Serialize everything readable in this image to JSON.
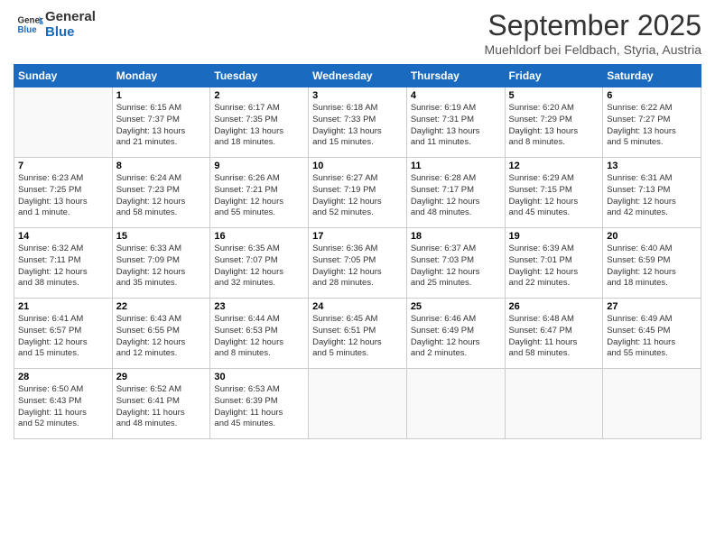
{
  "logo": {
    "line1": "General",
    "line2": "Blue"
  },
  "title": "September 2025",
  "subtitle": "Muehldorf bei Feldbach, Styria, Austria",
  "days_of_week": [
    "Sunday",
    "Monday",
    "Tuesday",
    "Wednesday",
    "Thursday",
    "Friday",
    "Saturday"
  ],
  "weeks": [
    [
      {
        "day": "",
        "info": ""
      },
      {
        "day": "1",
        "info": "Sunrise: 6:15 AM\nSunset: 7:37 PM\nDaylight: 13 hours\nand 21 minutes."
      },
      {
        "day": "2",
        "info": "Sunrise: 6:17 AM\nSunset: 7:35 PM\nDaylight: 13 hours\nand 18 minutes."
      },
      {
        "day": "3",
        "info": "Sunrise: 6:18 AM\nSunset: 7:33 PM\nDaylight: 13 hours\nand 15 minutes."
      },
      {
        "day": "4",
        "info": "Sunrise: 6:19 AM\nSunset: 7:31 PM\nDaylight: 13 hours\nand 11 minutes."
      },
      {
        "day": "5",
        "info": "Sunrise: 6:20 AM\nSunset: 7:29 PM\nDaylight: 13 hours\nand 8 minutes."
      },
      {
        "day": "6",
        "info": "Sunrise: 6:22 AM\nSunset: 7:27 PM\nDaylight: 13 hours\nand 5 minutes."
      }
    ],
    [
      {
        "day": "7",
        "info": "Sunrise: 6:23 AM\nSunset: 7:25 PM\nDaylight: 13 hours\nand 1 minute."
      },
      {
        "day": "8",
        "info": "Sunrise: 6:24 AM\nSunset: 7:23 PM\nDaylight: 12 hours\nand 58 minutes."
      },
      {
        "day": "9",
        "info": "Sunrise: 6:26 AM\nSunset: 7:21 PM\nDaylight: 12 hours\nand 55 minutes."
      },
      {
        "day": "10",
        "info": "Sunrise: 6:27 AM\nSunset: 7:19 PM\nDaylight: 12 hours\nand 52 minutes."
      },
      {
        "day": "11",
        "info": "Sunrise: 6:28 AM\nSunset: 7:17 PM\nDaylight: 12 hours\nand 48 minutes."
      },
      {
        "day": "12",
        "info": "Sunrise: 6:29 AM\nSunset: 7:15 PM\nDaylight: 12 hours\nand 45 minutes."
      },
      {
        "day": "13",
        "info": "Sunrise: 6:31 AM\nSunset: 7:13 PM\nDaylight: 12 hours\nand 42 minutes."
      }
    ],
    [
      {
        "day": "14",
        "info": "Sunrise: 6:32 AM\nSunset: 7:11 PM\nDaylight: 12 hours\nand 38 minutes."
      },
      {
        "day": "15",
        "info": "Sunrise: 6:33 AM\nSunset: 7:09 PM\nDaylight: 12 hours\nand 35 minutes."
      },
      {
        "day": "16",
        "info": "Sunrise: 6:35 AM\nSunset: 7:07 PM\nDaylight: 12 hours\nand 32 minutes."
      },
      {
        "day": "17",
        "info": "Sunrise: 6:36 AM\nSunset: 7:05 PM\nDaylight: 12 hours\nand 28 minutes."
      },
      {
        "day": "18",
        "info": "Sunrise: 6:37 AM\nSunset: 7:03 PM\nDaylight: 12 hours\nand 25 minutes."
      },
      {
        "day": "19",
        "info": "Sunrise: 6:39 AM\nSunset: 7:01 PM\nDaylight: 12 hours\nand 22 minutes."
      },
      {
        "day": "20",
        "info": "Sunrise: 6:40 AM\nSunset: 6:59 PM\nDaylight: 12 hours\nand 18 minutes."
      }
    ],
    [
      {
        "day": "21",
        "info": "Sunrise: 6:41 AM\nSunset: 6:57 PM\nDaylight: 12 hours\nand 15 minutes."
      },
      {
        "day": "22",
        "info": "Sunrise: 6:43 AM\nSunset: 6:55 PM\nDaylight: 12 hours\nand 12 minutes."
      },
      {
        "day": "23",
        "info": "Sunrise: 6:44 AM\nSunset: 6:53 PM\nDaylight: 12 hours\nand 8 minutes."
      },
      {
        "day": "24",
        "info": "Sunrise: 6:45 AM\nSunset: 6:51 PM\nDaylight: 12 hours\nand 5 minutes."
      },
      {
        "day": "25",
        "info": "Sunrise: 6:46 AM\nSunset: 6:49 PM\nDaylight: 12 hours\nand 2 minutes."
      },
      {
        "day": "26",
        "info": "Sunrise: 6:48 AM\nSunset: 6:47 PM\nDaylight: 11 hours\nand 58 minutes."
      },
      {
        "day": "27",
        "info": "Sunrise: 6:49 AM\nSunset: 6:45 PM\nDaylight: 11 hours\nand 55 minutes."
      }
    ],
    [
      {
        "day": "28",
        "info": "Sunrise: 6:50 AM\nSunset: 6:43 PM\nDaylight: 11 hours\nand 52 minutes."
      },
      {
        "day": "29",
        "info": "Sunrise: 6:52 AM\nSunset: 6:41 PM\nDaylight: 11 hours\nand 48 minutes."
      },
      {
        "day": "30",
        "info": "Sunrise: 6:53 AM\nSunset: 6:39 PM\nDaylight: 11 hours\nand 45 minutes."
      },
      {
        "day": "",
        "info": ""
      },
      {
        "day": "",
        "info": ""
      },
      {
        "day": "",
        "info": ""
      },
      {
        "day": "",
        "info": ""
      }
    ]
  ]
}
